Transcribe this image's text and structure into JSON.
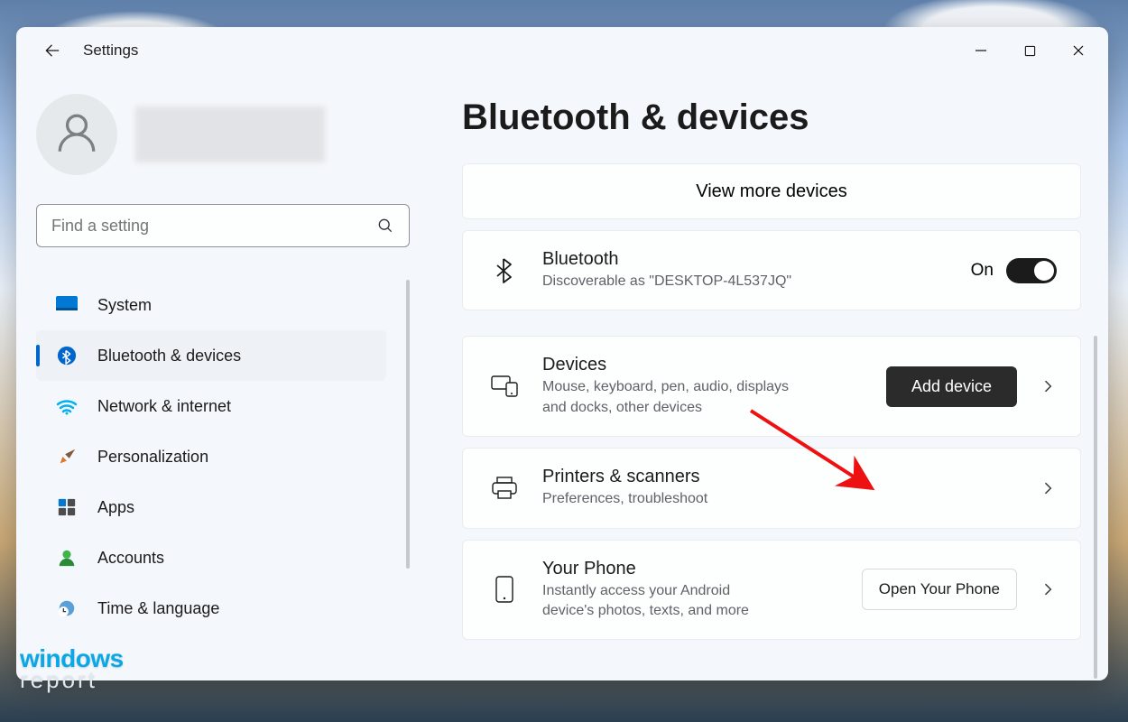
{
  "window": {
    "title": "Settings",
    "search_placeholder": "Find a setting"
  },
  "sidebar": {
    "items": [
      {
        "key": "system",
        "label": "System"
      },
      {
        "key": "bluetooth",
        "label": "Bluetooth & devices",
        "selected": true
      },
      {
        "key": "network",
        "label": "Network & internet"
      },
      {
        "key": "personalization",
        "label": "Personalization"
      },
      {
        "key": "apps",
        "label": "Apps"
      },
      {
        "key": "accounts",
        "label": "Accounts"
      },
      {
        "key": "time",
        "label": "Time & language"
      }
    ]
  },
  "page": {
    "title": "Bluetooth & devices",
    "view_more": "View more devices",
    "bluetooth": {
      "title": "Bluetooth",
      "sub": "Discoverable as \"DESKTOP-4L537JQ\"",
      "state_label": "On"
    },
    "devices": {
      "title": "Devices",
      "sub": "Mouse, keyboard, pen, audio, displays and docks, other devices",
      "add_button": "Add device"
    },
    "printers": {
      "title": "Printers & scanners",
      "sub": "Preferences, troubleshoot"
    },
    "phone": {
      "title": "Your Phone",
      "sub": "Instantly access your Android device's photos, texts, and more",
      "open_button": "Open Your Phone"
    }
  },
  "watermark": {
    "line1": "windows",
    "line2": "report"
  }
}
